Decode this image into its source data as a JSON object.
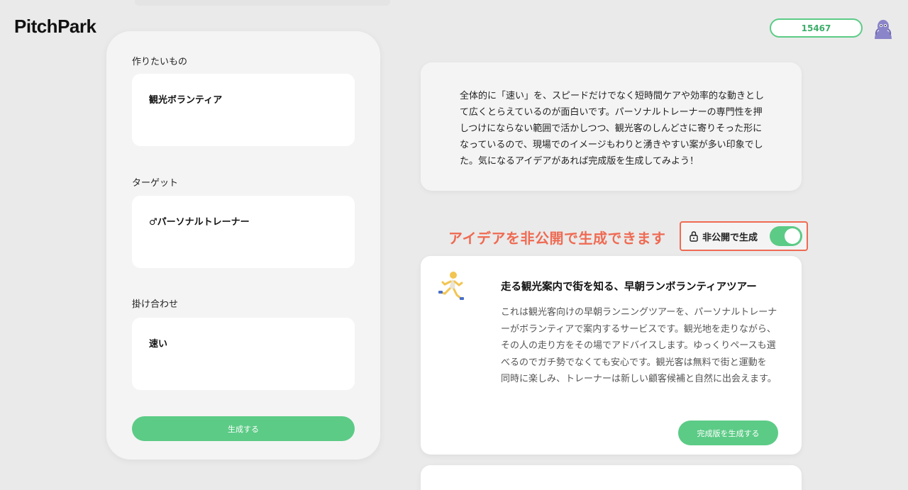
{
  "header": {
    "logo": "PitchPark",
    "points": "15467",
    "avatar_icon": "user-avatar-icon"
  },
  "form": {
    "fields": [
      {
        "label": "作りたいもの",
        "value": "観光ボランティア"
      },
      {
        "label": "ターゲット",
        "value": "♂パーソナルトレーナー"
      },
      {
        "label": "掛け合わせ",
        "value": "速い"
      }
    ],
    "generate_label": "生成する"
  },
  "summary": {
    "text_lines": [
      "全体的に「速い」を、スピードだけでなく短時間ケアや効率的な動きとし",
      "て広くとらえているのが面白いです。パーソナルトレーナーの専門性を押",
      "しつけにならない範囲で活かしつつ、観光客のしんどさに寄りそった形に",
      "なっているので、現場でのイメージもわりと湧きやすい案が多い印象でし",
      "た。気になるアイデアがあれば完成版を生成してみよう！"
    ]
  },
  "private_option": {
    "note": "アイデアを非公開で生成できます",
    "toggle_label": "非公開で生成",
    "enabled": true,
    "lock_icon": "lock-icon"
  },
  "ideas": [
    {
      "emoji_icon": "running-person-icon",
      "title": "走る観光案内で街を知る、早朝ランボランティアツアー",
      "description_lines": [
        "これは観光客向けの早朝ランニングツアーを、パーソナルトレーナ",
        "ーがボランティアで案内するサービスです。観光地を走りながら、",
        "その人の走り方をその場でアドバイスします。ゆっくりペースも選",
        "べるのでガチ勢でなくても安心です。観光客は無料で街と運動を",
        "同時に楽しみ、トレーナーは新しい顧客候補と自然に出会えます。"
      ],
      "final_button_label": "完成版を生成する"
    }
  ],
  "colors": {
    "accent_green": "#5ccb86",
    "warning_red": "#ef6a52"
  }
}
